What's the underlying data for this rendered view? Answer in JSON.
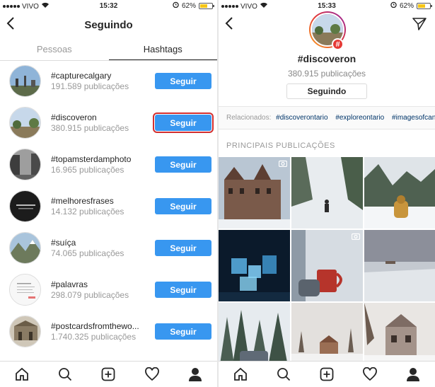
{
  "status_left": {
    "carrier": "VIVO",
    "time": "15:32",
    "battery": "62%"
  },
  "status_right": {
    "carrier": "VIVO",
    "time": "15:33",
    "battery": "62%"
  },
  "left": {
    "title": "Seguindo",
    "tabs": [
      {
        "label": "Pessoas"
      },
      {
        "label": "Hashtags"
      }
    ],
    "items": [
      {
        "name": "#capturecalgary",
        "count": "191.589 publicações",
        "button": "Seguir"
      },
      {
        "name": "#discoveron",
        "count": "380.915 publicações",
        "button": "Seguir"
      },
      {
        "name": "#topamsterdamphoto",
        "count": "16.965 publicações",
        "button": "Seguir"
      },
      {
        "name": "#melhoresfrases",
        "count": "14.132 publicações",
        "button": "Seguir"
      },
      {
        "name": "#suíça",
        "count": "74.065 publicações",
        "button": "Seguir"
      },
      {
        "name": "#palavras",
        "count": "298.079 publicações",
        "button": "Seguir"
      },
      {
        "name": "#postcardsfromthewo...",
        "count": "1.740.325 publicações",
        "button": "Seguir"
      }
    ]
  },
  "right": {
    "hashtag": "#discoveron",
    "count": "380.915 publicações",
    "button": "Seguindo",
    "related_label": "Relacionados:",
    "related": [
      "#discoverontario",
      "#exploreontario",
      "#imagesofcanada"
    ],
    "section_title": "PRINCIPAIS PUBLICAÇÕES"
  },
  "colors": {
    "accent": "#3897f0",
    "highlight": "#d32f2f",
    "badge": "#e53935"
  },
  "icons": [
    "home-icon",
    "search-icon",
    "add-post-icon",
    "heart-icon",
    "profile-icon"
  ]
}
